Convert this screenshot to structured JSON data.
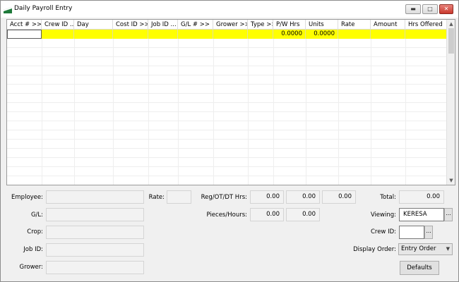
{
  "window": {
    "title": "Daily Payroll Entry",
    "controls": {
      "minimize": "▬",
      "maximize": "□",
      "close": "✕"
    }
  },
  "grid": {
    "columns": [
      "Acct # >>",
      "Crew ID ...",
      "Day",
      "Cost ID >>",
      "Job ID ...",
      "G/L # >>",
      "Grower >>",
      "Type >>",
      "P/W Hrs",
      "Units",
      "Rate",
      "Amount",
      "Hrs Offered"
    ],
    "row": [
      "",
      "",
      "",
      "",
      "",
      "",
      "",
      "",
      "0.0000",
      "0.0000",
      "",
      "",
      ""
    ],
    "highlight_color": "#ffff00"
  },
  "form": {
    "employee_label": "Employee:",
    "gl_label": "G/L:",
    "crop_label": "Crop:",
    "job_id_label": "Job ID:",
    "grower_label": "Grower:",
    "rate_label": "Rate:",
    "reg_ot_dt_label": "Reg/OT/DT Hrs:",
    "reg_hrs": "0.00",
    "ot_hrs": "0.00",
    "dt_hrs": "0.00",
    "pieces_hours_label": "Pieces/Hours:",
    "pieces": "0.00",
    "hours": "0.00",
    "total_label": "Total:",
    "total": "0.00",
    "viewing_label": "Viewing:",
    "viewing_value": "KERESA",
    "crew_id_label": "Crew ID:",
    "crew_id_value": "",
    "display_order_label": "Display Order:",
    "display_order_value": "Entry Order",
    "ellipsis": "...",
    "defaults_button": "Defaults"
  }
}
